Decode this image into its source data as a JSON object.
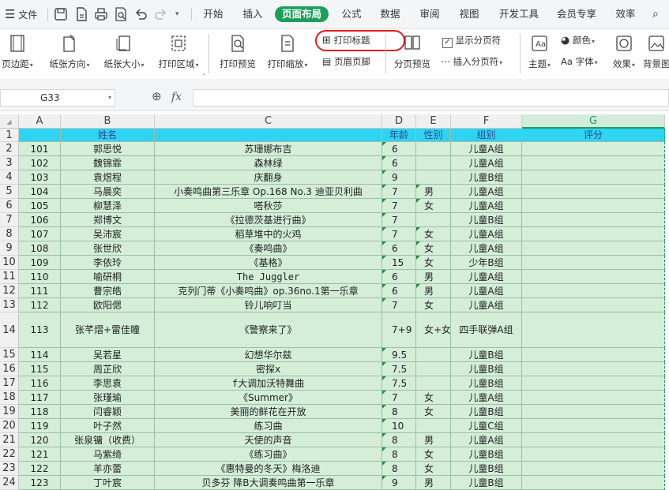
{
  "menubar": {
    "file_label": "文件",
    "tabs": [
      "开始",
      "插入",
      "页面布局",
      "公式",
      "数据",
      "审阅",
      "视图",
      "开发工具",
      "会员专享",
      "效率"
    ],
    "active_tab": "页面布局"
  },
  "ribbon": {
    "margins": "页边距",
    "orientation": "纸张方向",
    "size": "纸张大小",
    "print_area": "打印区域",
    "print_preview": "打印预览",
    "print_scale": "打印缩放",
    "print_titles": "打印标题",
    "header_footer": "页眉页脚",
    "page_break_preview": "分页预览",
    "show_page_breaks": "显示分页符",
    "insert_page_break": "插入分页符",
    "theme": "主题",
    "colors": "颜色",
    "fonts": "字体",
    "effects": "效果",
    "background": "背景图"
  },
  "formula_bar": {
    "name_box": "G33",
    "fx_label": "fx",
    "formula": ""
  },
  "columns": [
    "A",
    "B",
    "C",
    "D",
    "E",
    "F",
    "G"
  ],
  "selected_column": "G",
  "header_row": {
    "row_num": "1",
    "cells": [
      "",
      "姓名",
      "",
      "年龄",
      "性别",
      "组别",
      "评分"
    ]
  },
  "rows": [
    {
      "n": "2",
      "a": "101",
      "b": "郭思悦",
      "c": "苏珊娜布吉",
      "d": "6",
      "e": "",
      "f": "儿童A组"
    },
    {
      "n": "3",
      "a": "102",
      "b": "魏锦霏",
      "c": "森林绿",
      "d": "6",
      "e": "",
      "f": "儿童A组"
    },
    {
      "n": "4",
      "a": "103",
      "b": "袁煜程",
      "c": "庆翻身",
      "d": "9",
      "e": "",
      "f": "儿童B组"
    },
    {
      "n": "5",
      "a": "104",
      "b": "马晨奕",
      "c": "小奏鸣曲第三乐章 Op.168 No.3 迪亚贝利曲",
      "d": "7",
      "e": "男",
      "f": "儿童A组"
    },
    {
      "n": "6",
      "a": "105",
      "b": "柳慧泽",
      "c": "嗒秋莎",
      "d": "7",
      "e": "女",
      "f": "儿童A组"
    },
    {
      "n": "7",
      "a": "106",
      "b": "郑博文",
      "c": "《拉德茨基进行曲》",
      "d": "7",
      "e": "",
      "f": "儿童B组"
    },
    {
      "n": "8",
      "a": "107",
      "b": "吴沛宸",
      "c": "稻草堆中的火鸡",
      "d": "7",
      "e": "女",
      "f": "儿童A组"
    },
    {
      "n": "9",
      "a": "108",
      "b": "张世欣",
      "c": "《奏鸣曲》",
      "d": "6",
      "e": "女",
      "f": "儿童A组"
    },
    {
      "n": "10",
      "a": "109",
      "b": "李依玲",
      "c": "《基格》",
      "d": "15",
      "e": "女",
      "f": "少年B组"
    },
    {
      "n": "11",
      "a": "110",
      "b": "喻研桐",
      "c": "The Juggler",
      "d": "6",
      "e": "男",
      "f": "儿童A组"
    },
    {
      "n": "12",
      "a": "111",
      "b": "曹宗皓",
      "c": "克列门蒂《小奏鸣曲》op.36no.1第一乐章",
      "d": "6",
      "e": "男",
      "f": "儿童A组"
    },
    {
      "n": "13",
      "a": "112",
      "b": "欧阳偲",
      "c": "铃儿响叮当",
      "d": "7",
      "e": "女",
      "f": "儿童A组"
    },
    {
      "n": "14",
      "a": "113",
      "b": "张芊熠+雷佳瞳",
      "c": "《警察来了》",
      "d": "7+9",
      "e": "女+女",
      "f": "四手联弹A组"
    },
    {
      "n": "15",
      "a": "114",
      "b": "吴若星",
      "c": "幻想华尔兹",
      "d": "9.5",
      "e": "",
      "f": "儿童B组"
    },
    {
      "n": "16",
      "a": "115",
      "b": "周芷欣",
      "c": "密探x",
      "d": "7.5",
      "e": "",
      "f": "儿童B组"
    },
    {
      "n": "17",
      "a": "116",
      "b": "李思袁",
      "c": "f大调加沃特舞曲",
      "d": "7.5",
      "e": "",
      "f": "儿童B组"
    },
    {
      "n": "18",
      "a": "117",
      "b": "张瑾瑜",
      "c": "《Summer》",
      "d": "7",
      "e": "女",
      "f": "儿童A组"
    },
    {
      "n": "19",
      "a": "118",
      "b": "闫睿颖",
      "c": "美丽的鲜花在开放",
      "d": "8",
      "e": "女",
      "f": "儿童B组"
    },
    {
      "n": "20",
      "a": "119",
      "b": "叶子然",
      "c": "练习曲",
      "d": "10",
      "e": "",
      "f": "儿童C组"
    },
    {
      "n": "21",
      "a": "120",
      "b": "张泉镛（收费）",
      "c": "天使的声音",
      "d": "8",
      "e": "男",
      "f": "儿童A组"
    },
    {
      "n": "22",
      "a": "121",
      "b": "马紫绮",
      "c": "《练习曲》",
      "d": "8",
      "e": "女",
      "f": "儿童B组"
    },
    {
      "n": "23",
      "a": "122",
      "b": "羊亦蕾",
      "c": "《惠特曼的冬天》梅洛迪",
      "d": "8",
      "e": "女",
      "f": "儿童B组"
    },
    {
      "n": "24",
      "a": "123",
      "b": "丁叶宸",
      "c": "贝多芬 降B大调奏鸣曲第一乐章",
      "d": "9",
      "e": "男",
      "f": "儿童B组"
    }
  ]
}
